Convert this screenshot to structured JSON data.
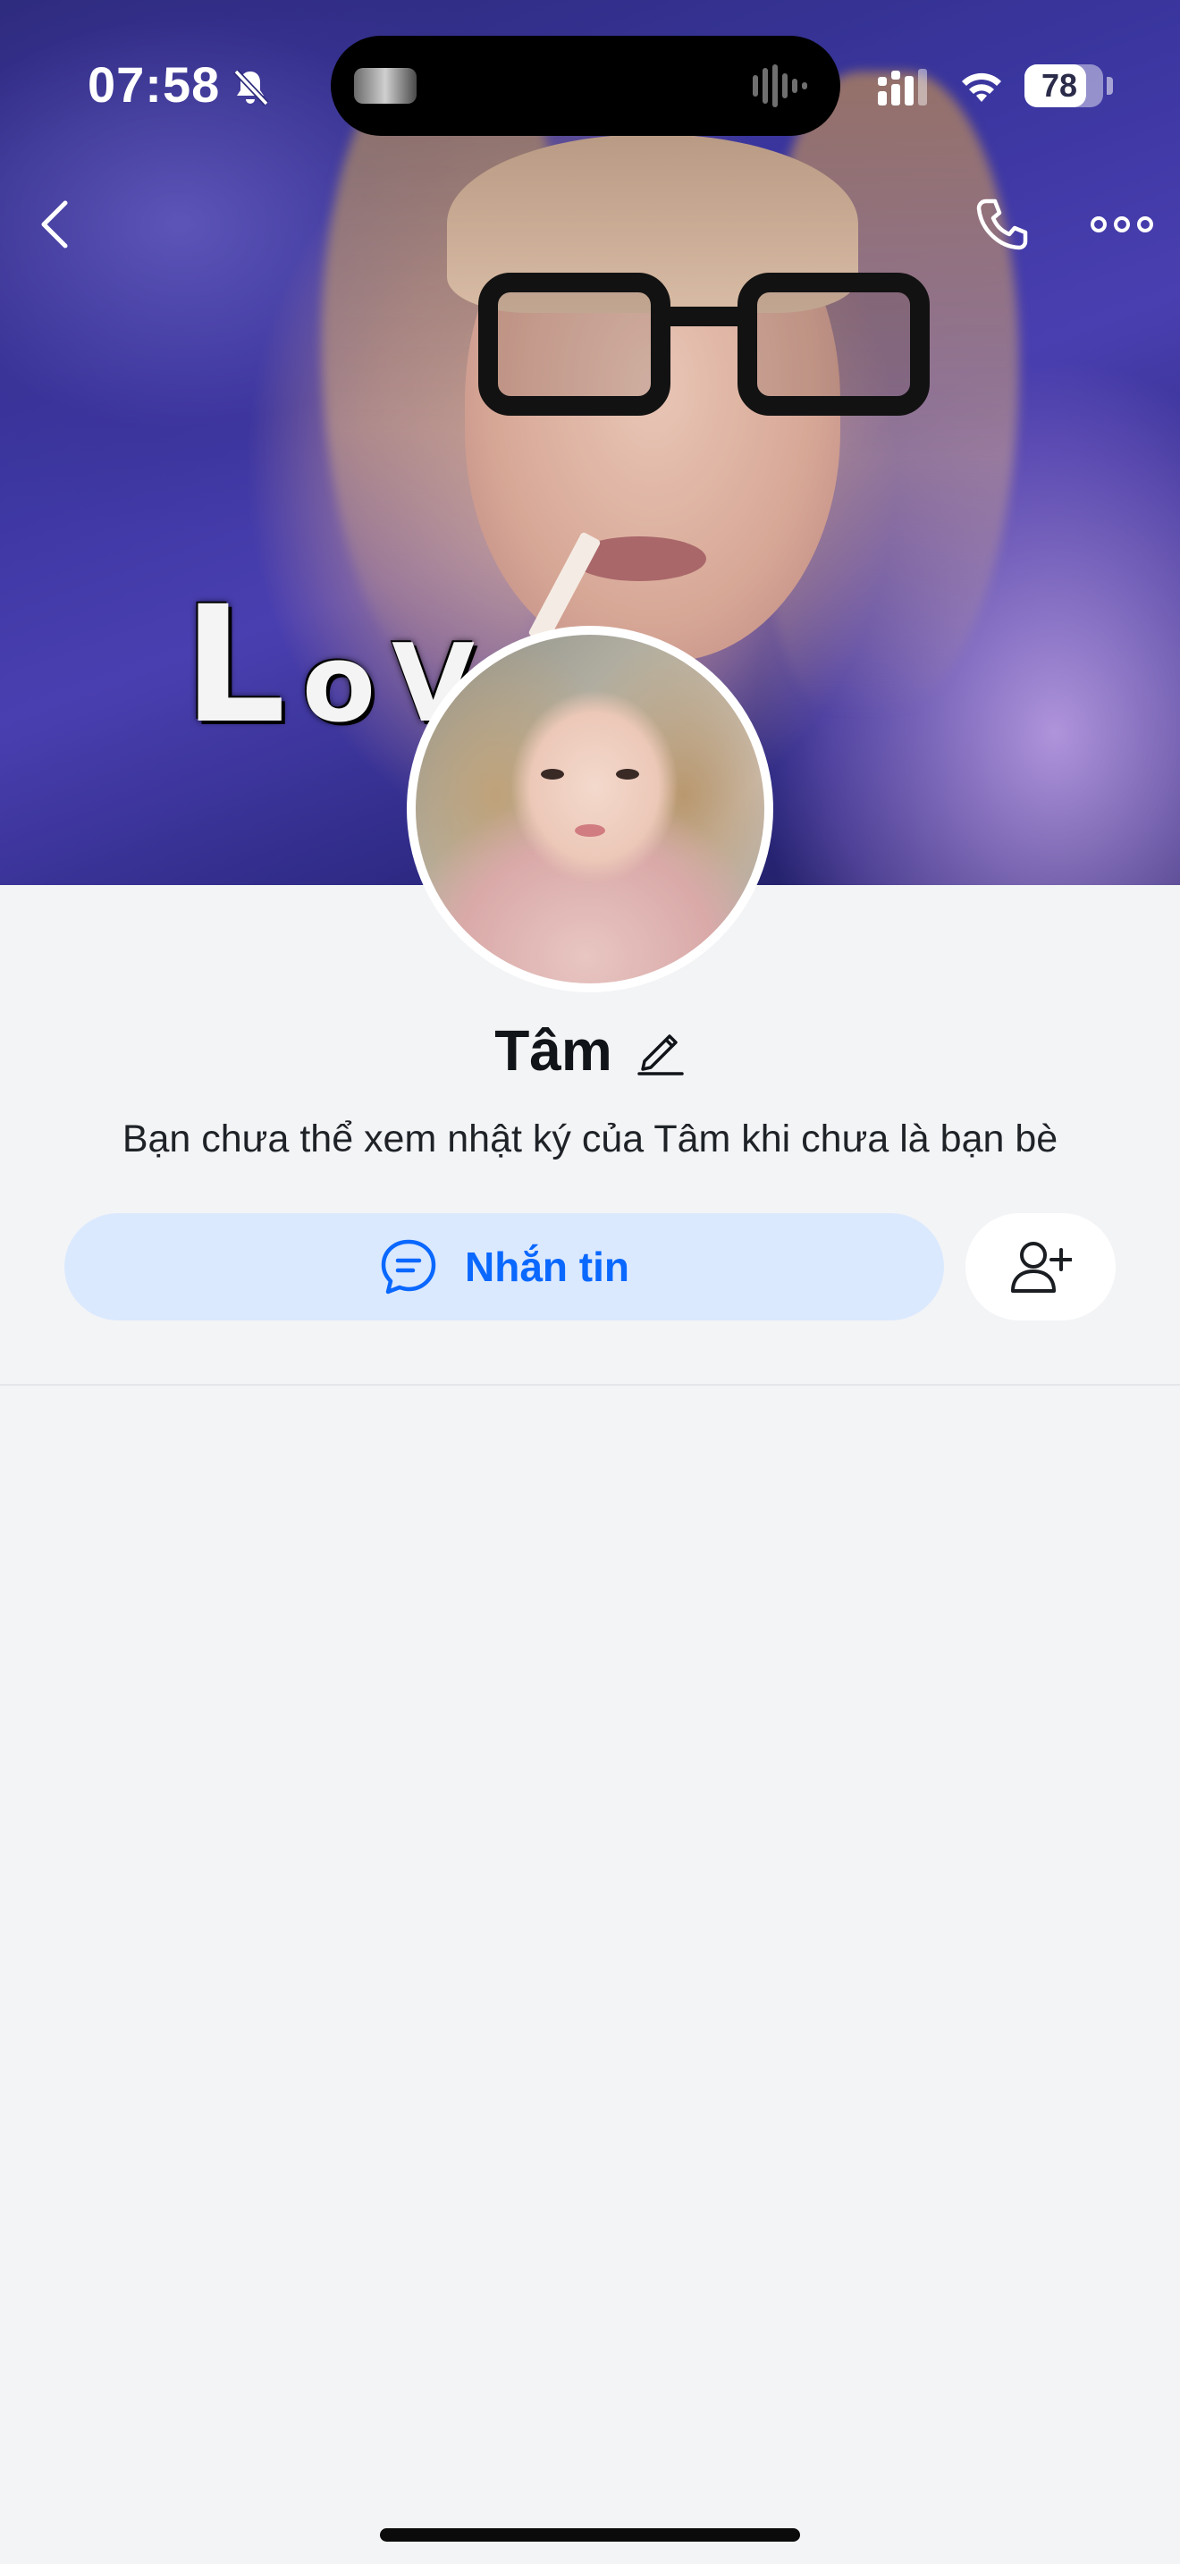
{
  "status_bar": {
    "time": "07:58",
    "battery_level": "78",
    "battery_fraction": 0.78,
    "icons": [
      "bell-muted-icon",
      "signal-icon",
      "wifi-icon",
      "battery-icon"
    ]
  },
  "cover": {
    "overlay_text_big": "L",
    "overlay_text_small": "oV"
  },
  "nav": {
    "icons": [
      "chevron-left-icon",
      "phone-icon",
      "more-dots-icon"
    ]
  },
  "profile": {
    "name": "Tâm",
    "bio": "Bạn chưa thể xem nhật ký của Tâm khi chưa là bạn bè"
  },
  "actions": {
    "message_label": "Nhắn tin",
    "message_icon": "chat-bubble-icon",
    "add_friend_icon": "add-user-icon"
  },
  "colors": {
    "accent": "#0a68ff",
    "message_button_bg": "#dbe9fe",
    "page_bg": "#f3f4f6"
  }
}
